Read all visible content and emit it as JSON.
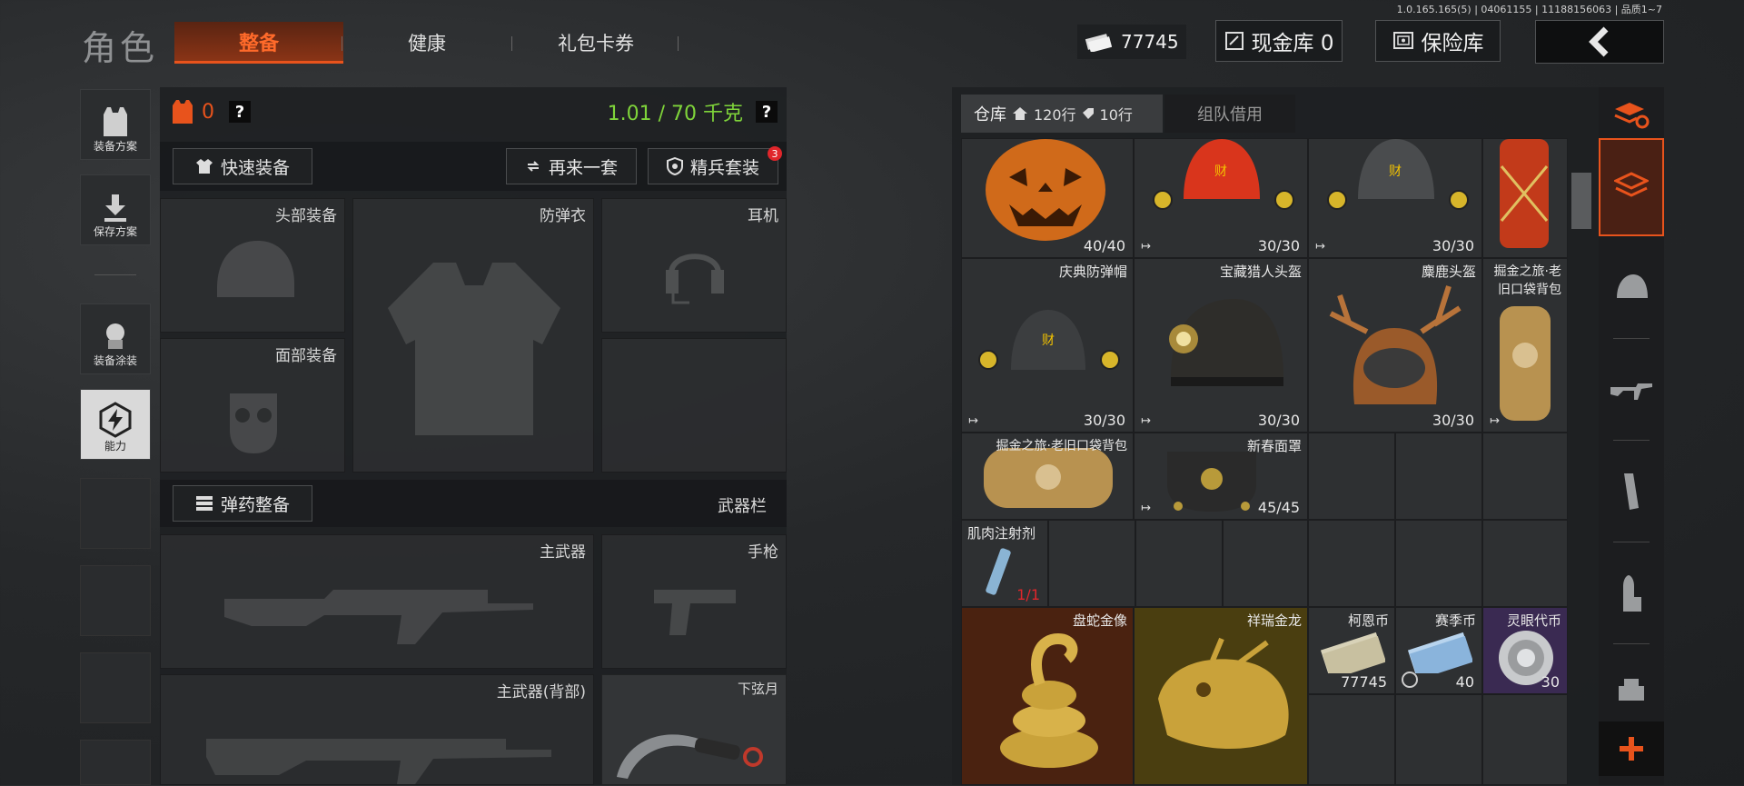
{
  "version": "1.0.165.165(5) | 04061155 | 11188156063 | 品质1~7",
  "header": {
    "title": "角色",
    "tabs": [
      {
        "label": "整备",
        "active": true
      },
      {
        "label": "健康",
        "active": false
      },
      {
        "label": "礼包卡券",
        "active": false
      }
    ],
    "currency_value": "77745",
    "cash_vault_label": "现金库 0",
    "safe_label": "保险库",
    "back_icon": "chevron-left-icon"
  },
  "colors": {
    "accent": "#e8531c",
    "weight_green": "#7fd43a",
    "gold": "#c9a23a"
  },
  "left_sidebar": [
    {
      "label": "装备方案",
      "icon": "vest-icon"
    },
    {
      "label": "保存方案",
      "icon": "download-icon"
    },
    {
      "label": "装备涂装",
      "icon": "spray-icon"
    },
    {
      "label": "能力",
      "icon": "bolt-hexagon-icon"
    }
  ],
  "equipment": {
    "armor_count": "0",
    "help": "?",
    "weight_text": "1.01 / 70 千克",
    "quick_equip_label": "快速装备",
    "again_label": "再来一套",
    "elite_label": "精兵套装",
    "elite_badge": "3",
    "slots": {
      "head": "头部装备",
      "vest": "防弹衣",
      "headset": "耳机",
      "face": "面部装备"
    },
    "ammo_label": "弹药整备",
    "weapon_bar_label": "武器栏",
    "weapons": {
      "primary": "主武器",
      "pistol": "手枪",
      "primary_back": "主武器(背部)",
      "melee": "下弦月"
    }
  },
  "warehouse": {
    "tab_label": "仓库",
    "rows_main": "120行",
    "rows_sub": "10行",
    "team_tab": "组队借用",
    "items": [
      {
        "id": "pumpkin",
        "name": "",
        "count": "40/40"
      },
      {
        "id": "helm-red",
        "name": "",
        "count": "30/30"
      },
      {
        "id": "helm-gray",
        "name": "",
        "count": "30/30"
      },
      {
        "id": "backpack-top",
        "name": "",
        "count": ""
      },
      {
        "id": "celebration-helmet",
        "name": "庆典防弹帽",
        "count": "30/30"
      },
      {
        "id": "treasure-helmet",
        "name": "宝藏猎人头盔",
        "count": "30/30"
      },
      {
        "id": "deer-helmet",
        "name": "麋鹿头盔",
        "count": "30/30"
      },
      {
        "id": "gold-backpack-v",
        "name": "掘金之旅·老旧口袋背包",
        "count": ""
      },
      {
        "id": "gold-backpack-h",
        "name": "掘金之旅·老旧口袋背包",
        "count": ""
      },
      {
        "id": "newyear-mask",
        "name": "新春面罩",
        "count": "45/45"
      },
      {
        "id": "muscle-injector",
        "name": "肌肉注射剂",
        "count": "1/1"
      },
      {
        "id": "snake-statue",
        "name": "盘蛇金像",
        "count": ""
      },
      {
        "id": "golden-dragon",
        "name": "祥瑞金龙",
        "count": ""
      },
      {
        "id": "koen-coin",
        "name": "柯恩币",
        "count": "77745"
      },
      {
        "id": "season-coin",
        "name": "赛季币",
        "count": "40"
      },
      {
        "id": "spirit-coin",
        "name": "灵眼代币",
        "count": "30"
      }
    ]
  },
  "right_tabs": [
    "layers-refresh-icon",
    "layers-icon",
    "helmet-icon",
    "rifle-icon",
    "magazine-icon",
    "ammo-icon",
    "scope-icon",
    "plus-icon"
  ]
}
